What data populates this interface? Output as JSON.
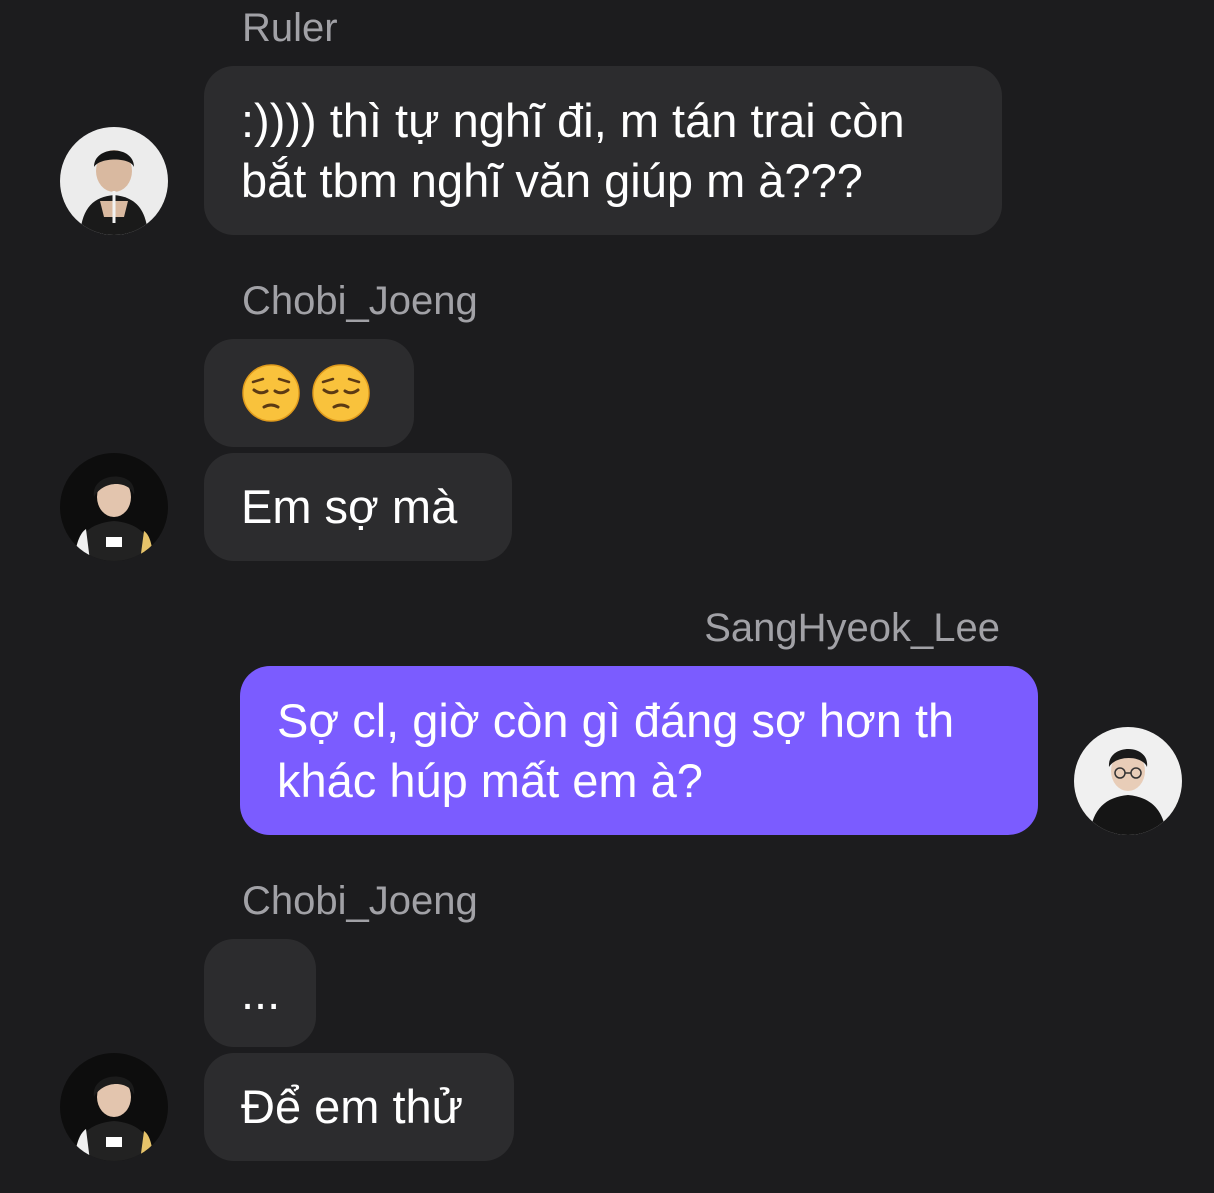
{
  "messages": [
    {
      "sender": "Ruler",
      "lines": [
        ":)))) thì tự nghĩ đi, m tán trai còn",
        "bắt tbm nghĩ văn giúp m à???"
      ]
    },
    {
      "sender": "Chobi_Joeng",
      "emojis": [
        "pensive-face",
        "pensive-face"
      ],
      "text": "Em sợ mà"
    },
    {
      "sender": "SangHyeok_Lee",
      "lines": [
        "Sợ cl, giờ còn gì đáng sợ hơn th",
        "khác húp mất em à?"
      ]
    },
    {
      "sender": "Chobi_Joeng",
      "ellipsis": "...",
      "text": "Để em thử"
    }
  ],
  "colors": {
    "background": "#1c1c1e",
    "incoming_bubble": "#2c2c2e",
    "outgoing_bubble": "#7b5cff",
    "sender_name": "#a1a1a6"
  }
}
